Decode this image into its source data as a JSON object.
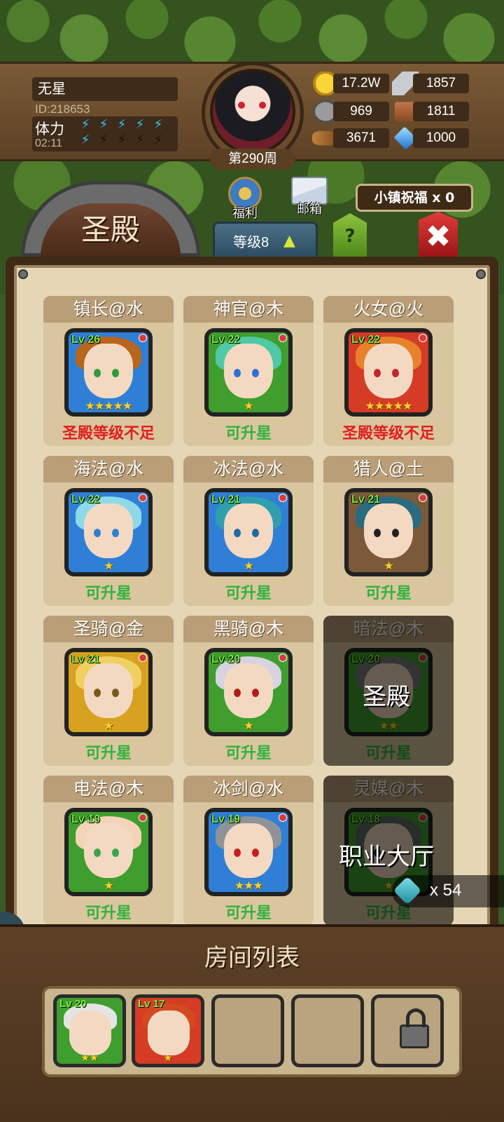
{
  "player": {
    "name": "无星",
    "id": "ID:218653",
    "stamina_label": "体力",
    "stamina_timer": "02:11",
    "stamina_full": 6,
    "stamina_total": 10,
    "week": "第290周"
  },
  "resources": {
    "gold": "17.2W",
    "iron": "1857",
    "stone": "969",
    "leather": "1811",
    "wood": "3671",
    "crystal": "1000"
  },
  "header": {
    "building_title": "圣殿",
    "welfare_label": "福利",
    "mail_label": "邮箱",
    "level_label": "等级8",
    "help_label": "?",
    "blessing_label": "小镇祝福 x 0",
    "close_label": "✖"
  },
  "heroes": [
    {
      "title": "镇长@水",
      "lv": "Lv 26",
      "stars": 5,
      "status": "圣殿等级不足",
      "status_type": "bad",
      "frame": "blue",
      "hair": "#b8651d",
      "eye": "#2e9b3c"
    },
    {
      "title": "神官@木",
      "lv": "Lv 22",
      "stars": 1,
      "status": "可升星",
      "status_type": "ok",
      "frame": "green",
      "hair": "#4fc9a6",
      "eye": "#2f6fd8"
    },
    {
      "title": "火女@火",
      "lv": "Lv 22",
      "stars": 5,
      "status": "圣殿等级不足",
      "status_type": "bad",
      "frame": "red",
      "hair": "#e8822a",
      "eye": "#c4262d"
    },
    {
      "title": "海法@水",
      "lv": "Lv 22",
      "stars": 1,
      "status": "可升星",
      "status_type": "ok",
      "frame": "blue",
      "hair": "#8ed9e8",
      "eye": "#2e7fd1"
    },
    {
      "title": "冰法@水",
      "lv": "Lv 21",
      "stars": 1,
      "status": "可升星",
      "status_type": "ok",
      "frame": "blue",
      "hair": "#2f9fb0",
      "eye": "#1f6ba0"
    },
    {
      "title": "猎人@土",
      "lv": "Lv 21",
      "stars": 1,
      "status": "可升星",
      "status_type": "ok",
      "frame": "brown",
      "hair": "#2b6b80",
      "eye": "#222222"
    },
    {
      "title": "圣骑@金",
      "lv": "Lv 21",
      "stars": 1,
      "status": "可升星",
      "status_type": "ok",
      "frame": "gold",
      "hair": "#f0cf63",
      "eye": "#7a5a1a"
    },
    {
      "title": "黑骑@木",
      "lv": "Lv 20",
      "stars": 1,
      "status": "可升星",
      "status_type": "ok",
      "frame": "green",
      "hair": "#d7d3e0",
      "eye": "#b01c1c"
    },
    {
      "title": "暗法@木",
      "lv": "Lv 20",
      "stars": 2,
      "status": "可升星",
      "status_type": "ok",
      "frame": "green",
      "hair": "#7a7a7a",
      "eye": "#222222",
      "dim": true
    },
    {
      "title": "电法@木",
      "lv": "Lv 19",
      "stars": 1,
      "status": "可升星",
      "status_type": "ok",
      "frame": "green",
      "hair": "#f3d4b8",
      "eye": "#3aa54b"
    },
    {
      "title": "冰剑@水",
      "lv": "Lv 19",
      "stars": 3,
      "status": "可升星",
      "status_type": "ok",
      "frame": "blue",
      "hair": "#8f9399",
      "eye": "#c42020"
    },
    {
      "title": "灵媒@木",
      "lv": "Lv 18",
      "stars": 1,
      "status": "可升星",
      "status_type": "ok",
      "frame": "green",
      "hair": "#5f6b66",
      "eye": "#222222",
      "dim": true
    }
  ],
  "overlay": {
    "temple_label": "圣殿",
    "hall_label": "职业大厅",
    "gem_count": "x 54",
    "app_tab": "ap"
  },
  "rooms": {
    "title": "房间列表",
    "slots": [
      {
        "lv": "Lv 20",
        "stars": 2,
        "frame": "green",
        "hair": "#e4e4e4"
      },
      {
        "lv": "Lv 17",
        "stars": 1,
        "frame": "red",
        "hair": "#d24a22"
      },
      {
        "empty": true
      },
      {
        "empty": true
      },
      {
        "locked": true
      }
    ]
  }
}
